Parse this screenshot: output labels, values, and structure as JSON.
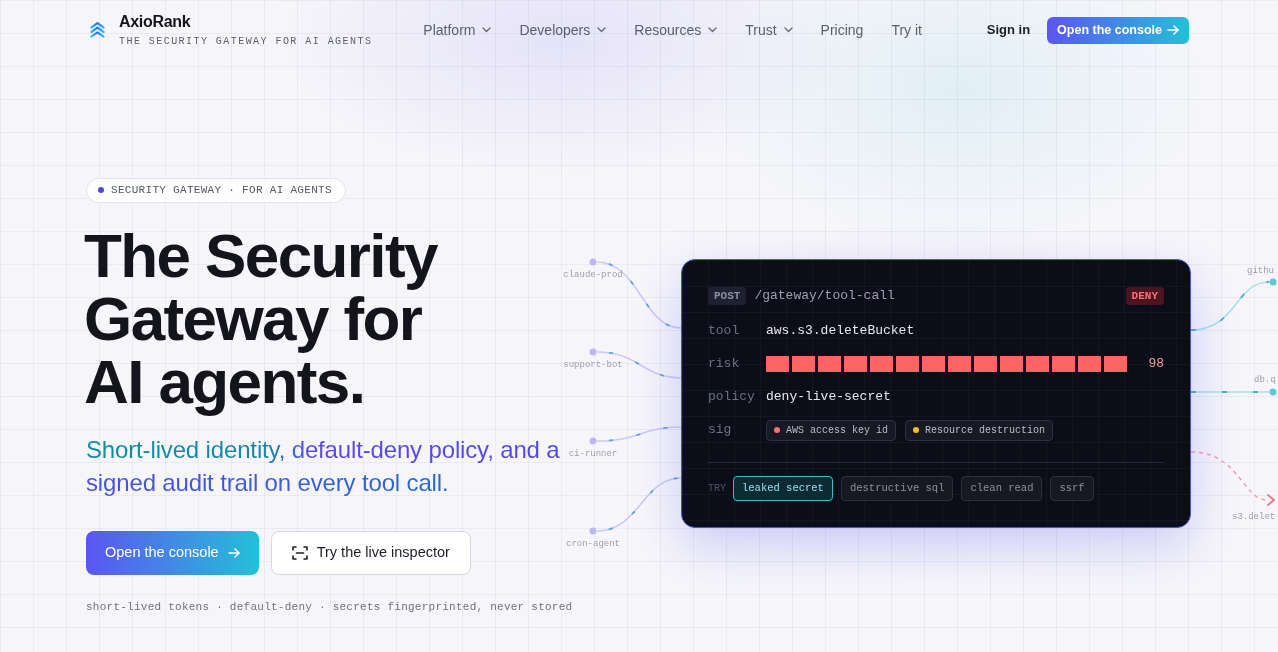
{
  "header": {
    "brand": "AxioRank",
    "tagline": "THE SECURITY GATEWAY FOR AI AGENTS",
    "nav": [
      {
        "label": "Platform",
        "dropdown": true
      },
      {
        "label": "Developers",
        "dropdown": true
      },
      {
        "label": "Resources",
        "dropdown": true
      },
      {
        "label": "Trust",
        "dropdown": true
      },
      {
        "label": "Pricing",
        "dropdown": false
      },
      {
        "label": "Try it",
        "dropdown": false
      }
    ],
    "sign_in": "Sign in",
    "cta": "Open the console"
  },
  "hero": {
    "eyebrow": "SECURITY GATEWAY · FOR AI AGENTS",
    "title_lines": [
      "The Security",
      "Gateway for",
      "AI agents."
    ],
    "subtitle_lines": [
      "Short-lived identity, default-deny policy, and a",
      "signed audit trail on every tool call."
    ],
    "buttons": [
      {
        "label": "Open the console",
        "kind": "primary"
      },
      {
        "label": "Try the live inspector",
        "kind": "secondary"
      }
    ],
    "footnote": "short-lived tokens · default-deny · secrets fingerprinted, never stored"
  },
  "diagram": {
    "agents": [
      "claude-prod",
      "support-bot",
      "ci-runner",
      "cron-agent"
    ],
    "targets": [
      {
        "label": "githu",
        "kind": "allow"
      },
      {
        "label": "db.q",
        "kind": "allow"
      },
      {
        "label": "s3.delet",
        "kind": "deny"
      }
    ],
    "inspector": {
      "method": "POST",
      "path": "/gateway/tool-call",
      "verdict": {
        "label": "DENY",
        "kind": "deny"
      },
      "fields": [
        {
          "kind": "text",
          "label": "tool",
          "value": "aws.s3.deleteBucket"
        },
        {
          "kind": "meter",
          "label": "risk",
          "level": 0.98,
          "reading": "98"
        },
        {
          "kind": "text",
          "label": "policy",
          "value": "deny-live-secret"
        },
        {
          "kind": "tags",
          "label": "sig",
          "tags": [
            {
              "label": "AWS access key id",
              "color": "#f87171"
            },
            {
              "label": "Resource destruction",
              "color": "#fbbf24"
            }
          ]
        }
      ],
      "try_label": "TRY",
      "samples": [
        {
          "label": "leaked secret",
          "selected": true
        },
        {
          "label": "destructive sql",
          "selected": false
        },
        {
          "label": "clean read",
          "selected": false
        },
        {
          "label": "ssrf",
          "selected": false
        }
      ]
    }
  }
}
